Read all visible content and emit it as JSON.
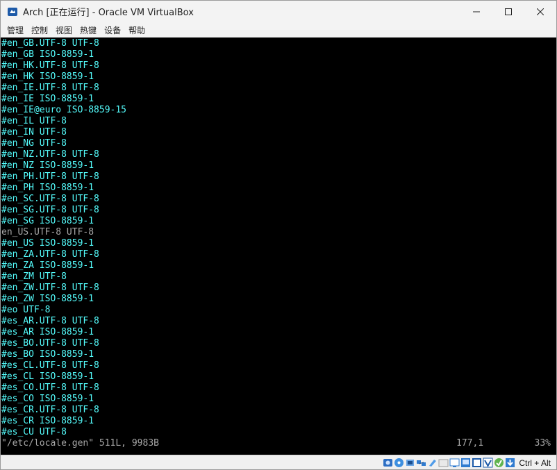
{
  "window": {
    "title": "Arch [正在运行] - Oracle VM VirtualBox",
    "controls": {
      "minimize": "—",
      "maximize": "☐",
      "close": "✕"
    }
  },
  "menu": [
    "管理",
    "控制",
    "视图",
    "热键",
    "设备",
    "帮助"
  ],
  "terminal": {
    "lines": [
      "#en_GB.UTF-8 UTF-8",
      "#en_GB ISO-8859-1",
      "#en_HK.UTF-8 UTF-8",
      "#en_HK ISO-8859-1",
      "#en_IE.UTF-8 UTF-8",
      "#en_IE ISO-8859-1",
      "#en_IE@euro ISO-8859-15",
      "#en_IL UTF-8",
      "#en_IN UTF-8",
      "#en_NG UTF-8",
      "#en_NZ.UTF-8 UTF-8",
      "#en_NZ ISO-8859-1",
      "#en_PH.UTF-8 UTF-8",
      "#en_PH ISO-8859-1",
      "#en_SC.UTF-8 UTF-8",
      "#en_SG.UTF-8 UTF-8",
      "#en_SG ISO-8859-1",
      "en_US.UTF-8 UTF-8",
      "#en_US ISO-8859-1",
      "#en_ZA.UTF-8 UTF-8",
      "#en_ZA ISO-8859-1",
      "#en_ZM UTF-8",
      "#en_ZW.UTF-8 UTF-8",
      "#en_ZW ISO-8859-1",
      "#eo UTF-8",
      "#es_AR.UTF-8 UTF-8",
      "#es_AR ISO-8859-1",
      "#es_BO.UTF-8 UTF-8",
      "#es_BO ISO-8859-1",
      "#es_CL.UTF-8 UTF-8",
      "#es_CL ISO-8859-1",
      "#es_CO.UTF-8 UTF-8",
      "#es_CO ISO-8859-1",
      "#es_CR.UTF-8 UTF-8",
      "#es_CR ISO-8859-1",
      "#es_CU UTF-8"
    ],
    "active_line_index": 17,
    "status": {
      "file_info": "\"/etc/locale.gen\" 511L, 9983B",
      "cursor": "177,1",
      "percent": "33%"
    },
    "colors": {
      "comment": "#54fcfc",
      "active": "#a8a8a8",
      "background": "#000000"
    }
  },
  "statusbar": {
    "icons": [
      "hard-disk-icon",
      "optical-drive-icon",
      "audio-icon",
      "network-icon",
      "usb-icon",
      "shared-folders-icon",
      "display-icon",
      "video-capture-icon",
      "virtualization-icon",
      "mouse-integration-icon",
      "host-key-icon"
    ],
    "host_key": "Ctrl + Alt"
  }
}
